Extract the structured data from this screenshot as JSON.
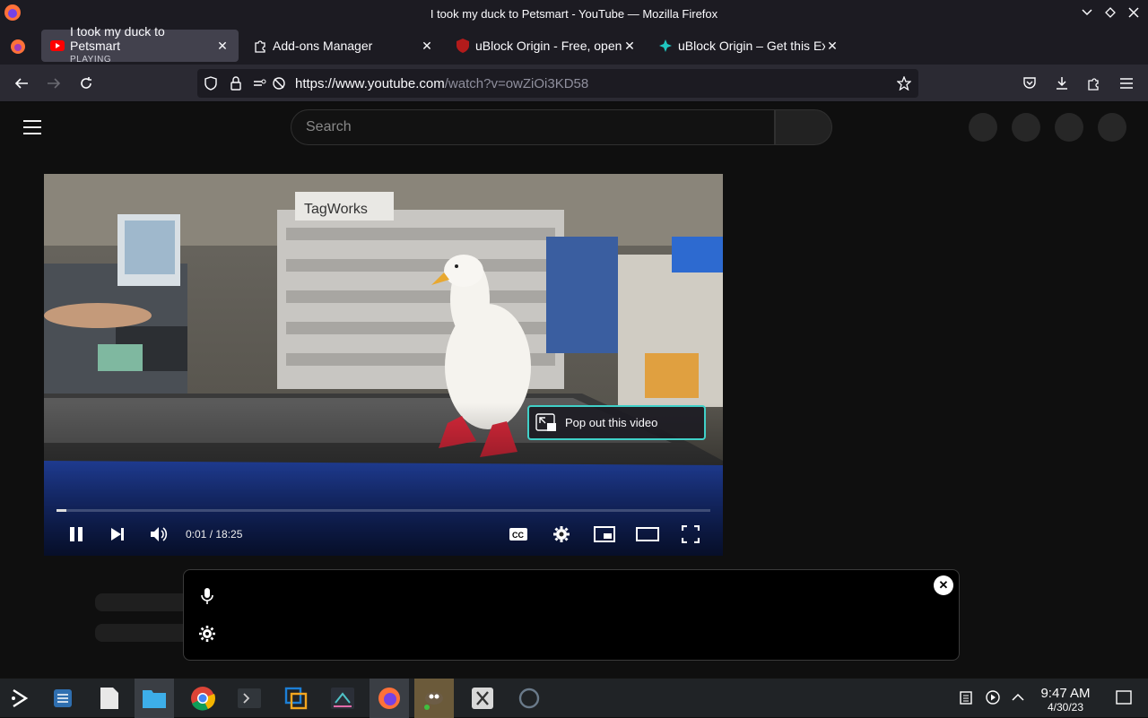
{
  "window": {
    "title": "I took my duck to Petsmart - YouTube — Mozilla Firefox"
  },
  "tabs": [
    {
      "title": "I took my duck to Petsmart",
      "sub": "PLAYING",
      "favicon": "youtube-icon",
      "active": true
    },
    {
      "title": "Add-ons Manager",
      "favicon": "puzzle-icon"
    },
    {
      "title": "uBlock Origin - Free, open",
      "favicon": "ublock-icon"
    },
    {
      "title": "uBlock Origin – Get this Ex",
      "favicon": "addon-icon"
    }
  ],
  "navbar": {
    "url_domain": "https://www.youtube.com",
    "url_path": "/watch?v=owZiOi3KD58"
  },
  "youtube": {
    "search_placeholder": "Search"
  },
  "player": {
    "time": "0:01 / 18:25",
    "progress": 0.015,
    "popout_label": "Pop out this video"
  },
  "taskbar": {
    "time": "9:47 AM",
    "date": "4/30/23"
  },
  "colors": {
    "accent": "#40d0c8",
    "youtube_red": "#ff0000"
  }
}
